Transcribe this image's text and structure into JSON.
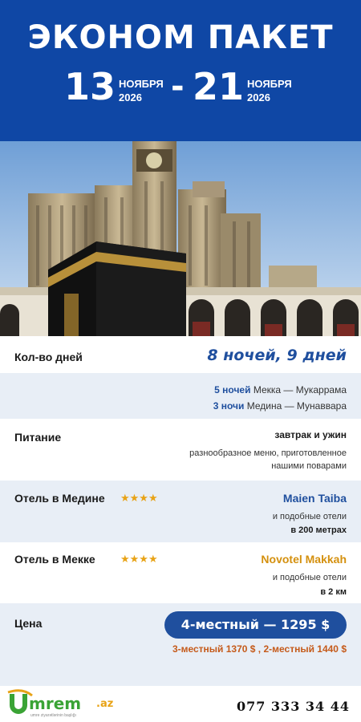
{
  "header": {
    "title": "ЭКОНОМ ПАКЕТ",
    "start_day": "13",
    "start_month": "НОЯБРЯ",
    "start_year": "2026",
    "separator": "-",
    "end_day": "21",
    "end_month": "НОЯБРЯ",
    "end_year": "2026"
  },
  "rows": {
    "days_label": "Кол-во дней",
    "days_value": "8 ночей, 9 дней",
    "mecca_nights": "5 ночей",
    "mecca_city": "Мекка — Мукаррама",
    "medina_nights": "3 ночи",
    "medina_city": "Медина — Мунаввара",
    "food_label": "Питание",
    "food_value": "завтрак и ужин",
    "food_note_1": "разнообразное меню, приготовленное",
    "food_note_2": "нашими поварами",
    "medina_hotel_label": "Отель в Медине",
    "medina_stars": "★★★★",
    "medina_hotel_name": "Maien Taiba",
    "medina_hotel_note": "и подобные отели",
    "medina_hotel_distance": "в 200 метрах",
    "mecca_hotel_label": "Отель в Мекке",
    "mecca_stars": "★★★★",
    "mecca_hotel_name": "Novotel Makkah",
    "mecca_hotel_note": "и подобные отели",
    "mecca_hotel_distance": "в 2 км",
    "price_label": "Цена",
    "price_main": "4-местный — 1295 $",
    "price_alt": "3-местный 1370 $  ,  2-местный 1440 $"
  },
  "footer": {
    "logo_text": "mrem",
    "logo_initial": "U",
    "logo_suffix": ".az",
    "logo_tagline": "umre ziyarətlərinin başlığı",
    "phone": "077 333 34 44"
  },
  "colors": {
    "header_bg": "#0f47a5",
    "accent_blue": "#1f4f9e",
    "star_gold": "#e8a317",
    "mecca_hotel": "#d4900e",
    "price_alt": "#c55a1a",
    "row_alt": "#e8eef6"
  }
}
